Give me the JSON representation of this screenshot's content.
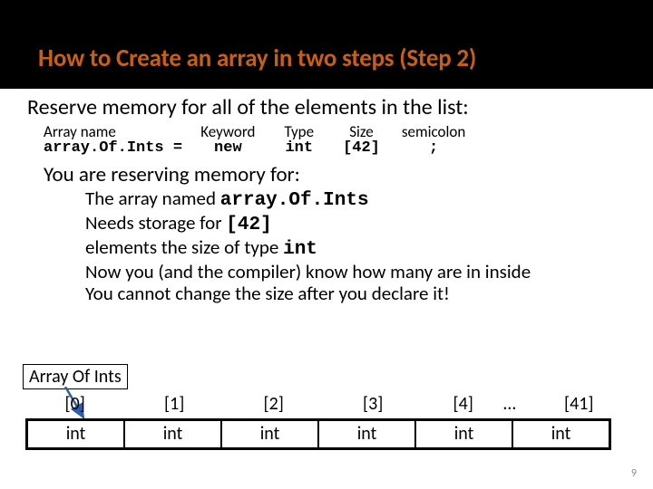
{
  "title": "How to Create an array in two steps (Step 2)",
  "heading1": "Reserve memory for all of the elements in the list:",
  "cols": [
    {
      "label": "Array name",
      "code": "array.Of.Ints = "
    },
    {
      "label": "Keyword",
      "code": "new"
    },
    {
      "label": "Type",
      "code": "int"
    },
    {
      "label": "Size",
      "code": "[42]"
    },
    {
      "label": "semicolon",
      "code": ";"
    }
  ],
  "heading2": "You are reserving memory for:",
  "lines": {
    "l1a": "The array named ",
    "l1b": "array.Of.Ints",
    "l2a": "Needs storage for ",
    "l2b": "[42]",
    "l3a": "elements the size of type ",
    "l3b": "int",
    "l4": "Now you (and the compiler) know how many are in inside",
    "l5": "You cannot change the size after you declare it!"
  },
  "arrayLabel": "Array Of Ints",
  "indices": [
    "[0]",
    "[1]",
    "[2]",
    "[3]",
    "[4]",
    "[41]"
  ],
  "dots": "…",
  "cells": [
    "int",
    "int",
    "int",
    "int",
    "int",
    "int"
  ],
  "pageNum": "9"
}
